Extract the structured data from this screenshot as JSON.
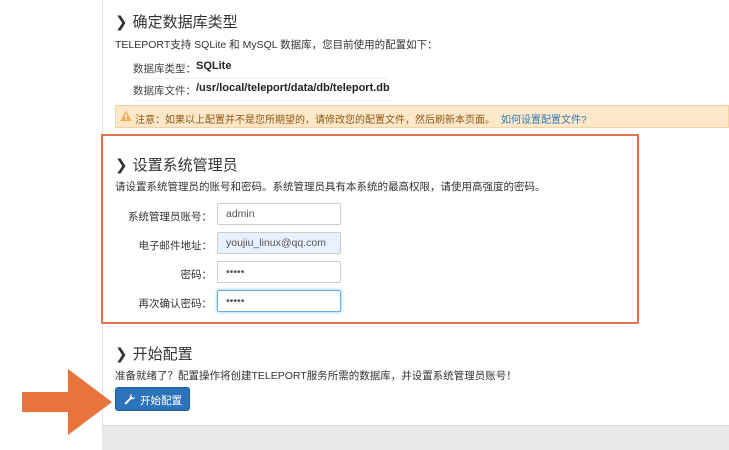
{
  "db_section": {
    "title": "确定数据库类型",
    "description": "TELEPORT支持 SQLite 和 MySQL 数据库，您目前使用的配置如下：",
    "rows": [
      {
        "label": "数据库类型：",
        "value": "SQLite"
      },
      {
        "label": "数据库文件：",
        "value": "/usr/local/teleport/data/db/teleport.db"
      }
    ]
  },
  "warning": {
    "text": "注意：如果以上配置并不是您所期望的，请修改您的配置文件，然后刷新本页面。",
    "link": "如何设置配置文件?",
    "color": "#fce7c8"
  },
  "admin_section": {
    "title": "设置系统管理员",
    "description": "请设置系统管理员的账号和密码。系统管理员具有本系统的最高权限，请使用高强度的密码。",
    "fields": [
      {
        "label": "系统管理员账号：",
        "value": "admin"
      },
      {
        "label": "电子邮件地址：",
        "value": "youjiu_linux@qq.com"
      },
      {
        "label": "密码：",
        "value": "•••••"
      },
      {
        "label": "再次确认密码：",
        "value": "•••••"
      }
    ]
  },
  "start_section": {
    "title": "开始配置",
    "description": "准备就绪了？配置操作将创建TELEPORT服务所需的数据库，并设置系统管理员账号！",
    "button": "开始配置"
  },
  "colors": {
    "highlight_border": "#e0764e",
    "arrow": "#e8743b",
    "button": "#2d73b9"
  }
}
